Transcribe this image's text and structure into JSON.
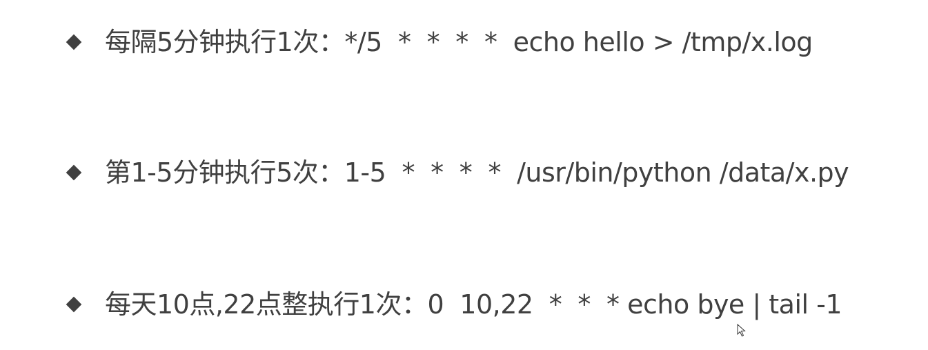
{
  "items": [
    {
      "text": "每隔5分钟执行1次：*/5  *  *  *  *  echo hello > /tmp/x.log"
    },
    {
      "text": "第1-5分钟执行5次：1-5  *  *  *  *  /usr/bin/python /data/x.py"
    },
    {
      "text": "每天10点,22点整执行1次：0  10,22  *  *  * echo bye | tail -1"
    }
  ],
  "icons": {
    "bullet": "diamond-bullet-icon",
    "pointer": "mouse-cursor-icon"
  },
  "colors": {
    "text": "#404040",
    "background": "#ffffff"
  }
}
